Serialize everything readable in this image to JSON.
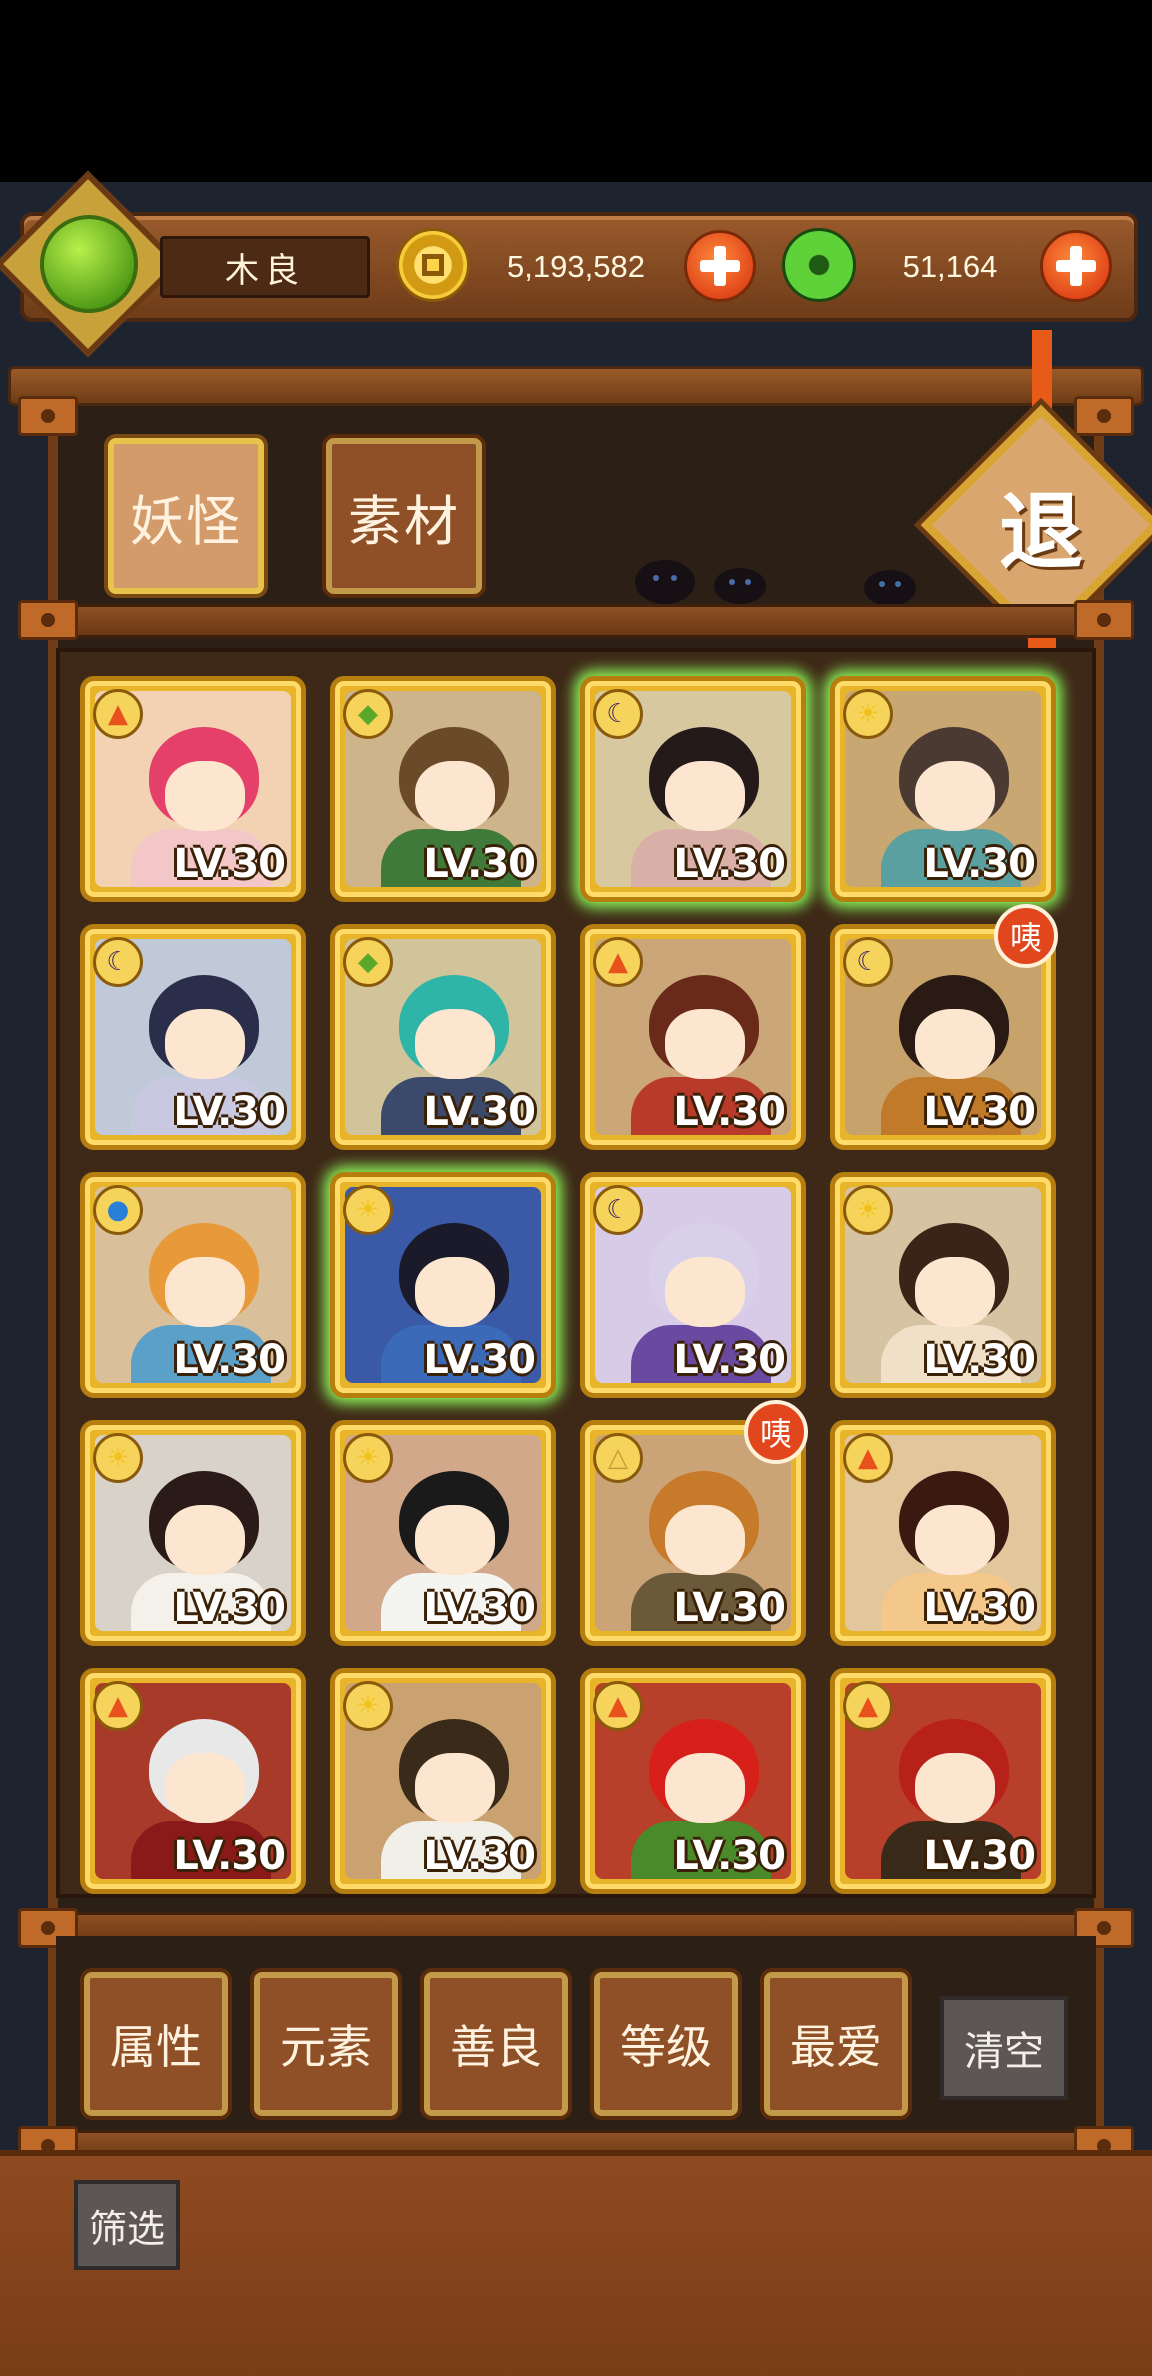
{
  "player": {
    "name": "木良"
  },
  "currency": {
    "coins": "5,193,582",
    "jade": "51,164"
  },
  "tabs": [
    {
      "label": "妖怪",
      "active": true
    },
    {
      "label": "素材",
      "active": false
    }
  ],
  "exit_label": "退",
  "cards": [
    {
      "element": "fire-icon",
      "level": "LV.30",
      "glow": false,
      "badge": null
    },
    {
      "element": "leaf-icon",
      "level": "LV.30",
      "glow": false,
      "badge": null
    },
    {
      "element": "moon-icon",
      "level": "LV.30",
      "glow": true,
      "badge": null
    },
    {
      "element": "sun-icon",
      "level": "LV.30",
      "glow": true,
      "badge": null
    },
    {
      "element": "moon-icon",
      "level": "LV.30",
      "glow": false,
      "badge": null
    },
    {
      "element": "leaf-icon",
      "level": "LV.30",
      "glow": false,
      "badge": null
    },
    {
      "element": "fire-icon",
      "level": "LV.30",
      "glow": false,
      "badge": null
    },
    {
      "element": "moon-icon",
      "level": "LV.30",
      "glow": false,
      "badge": "咦"
    },
    {
      "element": "water-icon",
      "level": "LV.30",
      "glow": false,
      "badge": null
    },
    {
      "element": "sun-icon",
      "level": "LV.30",
      "glow": true,
      "badge": null
    },
    {
      "element": "moon-icon",
      "level": "LV.30",
      "glow": false,
      "badge": null
    },
    {
      "element": "sun-icon",
      "level": "LV.30",
      "glow": false,
      "badge": null
    },
    {
      "element": "sun-icon",
      "level": "LV.30",
      "glow": false,
      "badge": null
    },
    {
      "element": "sun-icon",
      "level": "LV.30",
      "glow": false,
      "badge": null
    },
    {
      "element": "earth-icon",
      "level": "LV.30",
      "glow": false,
      "badge": "咦"
    },
    {
      "element": "fire-icon",
      "level": "LV.30",
      "glow": false,
      "badge": null
    },
    {
      "element": "fire-icon",
      "level": "LV.30",
      "glow": false,
      "badge": null
    },
    {
      "element": "sun-icon",
      "level": "LV.30",
      "glow": false,
      "badge": null
    },
    {
      "element": "fire-icon",
      "level": "LV.30",
      "glow": false,
      "badge": null
    },
    {
      "element": "fire-icon",
      "level": "LV.30",
      "glow": false,
      "badge": null
    }
  ],
  "filters": [
    "属性",
    "元素",
    "善良",
    "等级",
    "最爱"
  ],
  "clear_label": "清空",
  "screen_label": "筛选",
  "colors": {
    "fire": "#e8501c",
    "leaf": "#5aa82a",
    "moon": "#3a1f6a",
    "sun": "#f2c21a",
    "water": "#2a7fd6",
    "earth": "#c79a3a",
    "card_gold": "#e8b42a",
    "glow": "#8cf55a"
  }
}
